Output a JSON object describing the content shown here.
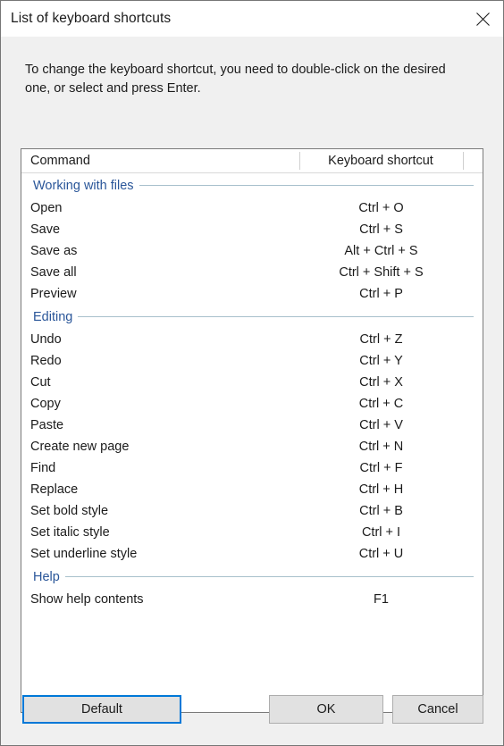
{
  "window": {
    "title": "List of keyboard shortcuts",
    "close_icon": "close-icon"
  },
  "instructions": "To change the keyboard shortcut, you need to double-click on the desired one, or select and press Enter.",
  "table": {
    "headers": {
      "command": "Command",
      "shortcut": "Keyboard shortcut"
    },
    "groups": [
      {
        "label": "Working with files",
        "rows": [
          {
            "command": "Open",
            "shortcut": "Ctrl + O"
          },
          {
            "command": "Save",
            "shortcut": "Ctrl + S"
          },
          {
            "command": "Save as",
            "shortcut": "Alt + Ctrl + S"
          },
          {
            "command": "Save all",
            "shortcut": "Ctrl + Shift + S"
          },
          {
            "command": "Preview",
            "shortcut": "Ctrl + P"
          }
        ]
      },
      {
        "label": "Editing",
        "rows": [
          {
            "command": "Undo",
            "shortcut": "Ctrl + Z"
          },
          {
            "command": "Redo",
            "shortcut": "Ctrl + Y"
          },
          {
            "command": "Cut",
            "shortcut": "Ctrl + X"
          },
          {
            "command": "Copy",
            "shortcut": "Ctrl + C"
          },
          {
            "command": "Paste",
            "shortcut": "Ctrl + V"
          },
          {
            "command": "Create new page",
            "shortcut": "Ctrl + N"
          },
          {
            "command": "Find",
            "shortcut": "Ctrl + F"
          },
          {
            "command": "Replace",
            "shortcut": "Ctrl + H"
          },
          {
            "command": "Set bold style",
            "shortcut": "Ctrl + B"
          },
          {
            "command": "Set italic style",
            "shortcut": "Ctrl + I"
          },
          {
            "command": "Set underline style",
            "shortcut": "Ctrl + U"
          }
        ]
      },
      {
        "label": "Help",
        "rows": [
          {
            "command": "Show help contents",
            "shortcut": "F1"
          }
        ]
      }
    ]
  },
  "buttons": {
    "default": "Default",
    "ok": "OK",
    "cancel": "Cancel"
  },
  "colors": {
    "focus_border": "#0078d7",
    "group_label": "#2a5699",
    "group_line": "#a8c0cc",
    "window_bg": "#f0f0f0",
    "listbox_bg": "#ffffff"
  }
}
